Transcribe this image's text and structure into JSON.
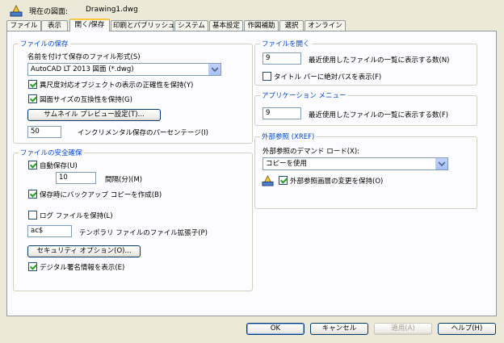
{
  "header": {
    "current_drawing_label": "現在の図面:",
    "current_drawing_value": "Drawing1.dwg"
  },
  "tabs": [
    {
      "label": "ファイル"
    },
    {
      "label": "表示"
    },
    {
      "label": "開く/保存"
    },
    {
      "label": "印刷とパブリッシュ"
    },
    {
      "label": "システム"
    },
    {
      "label": "基本設定"
    },
    {
      "label": "作図補助"
    },
    {
      "label": "選択"
    },
    {
      "label": "オンライン"
    }
  ],
  "file_save": {
    "title": "ファイルの保存",
    "format_label": "名前を付けて保存のファイル形式(S)",
    "format_value": "AutoCAD LT 2013 図面 (*.dwg)",
    "annotative_label": "異尺度対応オブジェクトの表示の正確性を保持(Y)",
    "annotative_checked": true,
    "drawing_size_label": "図面サイズの互換性を保持(G)",
    "drawing_size_checked": true,
    "thumbnail_button": "サムネイル プレビュー設定(T)...",
    "incremental_value": "50",
    "incremental_label": "インクリメンタル保存のパーセンテージ(I)"
  },
  "file_safety": {
    "title": "ファイルの安全確保",
    "autosave_label": "自動保存(U)",
    "autosave_checked": true,
    "interval_value": "10",
    "interval_label": "間隔(分)(M)",
    "backup_label": "保存時にバックアップ コピーを作成(B)",
    "backup_checked": true,
    "log_label": "ログ ファイルを保持(L)",
    "log_checked": false,
    "temp_ext_value": "ac$",
    "temp_ext_label": "テンポラリ ファイルのファイル拡張子(P)",
    "security_button": "セキュリティ オプション(O)...",
    "digital_sig_label": "デジタル署名情報を表示(E)",
    "digital_sig_checked": true
  },
  "file_open": {
    "title": "ファイルを開く",
    "recent_value": "9",
    "recent_label": "最近使用したファイルの一覧に表示する数(N)",
    "fullpath_label": "タイトル バーに絶対パスを表示(F)",
    "fullpath_checked": false
  },
  "app_menu": {
    "title": "アプリケーション メニュー",
    "recent_value": "9",
    "recent_label": "最近使用したファイルの一覧に表示する数(F)"
  },
  "xref": {
    "title": "外部参照 (XREF)",
    "demand_label": "外部参照のデマンド ロード(X):",
    "demand_value": "コピーを使用",
    "retain_label": "外部参照画層の変更を保持(O)",
    "retain_checked": true
  },
  "buttons": {
    "ok": "OK",
    "cancel": "キャンセル",
    "apply": "適用(A)",
    "help": "ヘルプ(H)"
  },
  "icons": {
    "drawing": "drawing-file-icon",
    "xref": "xref-drawing-icon",
    "dropdown": "chevron-down-icon"
  }
}
